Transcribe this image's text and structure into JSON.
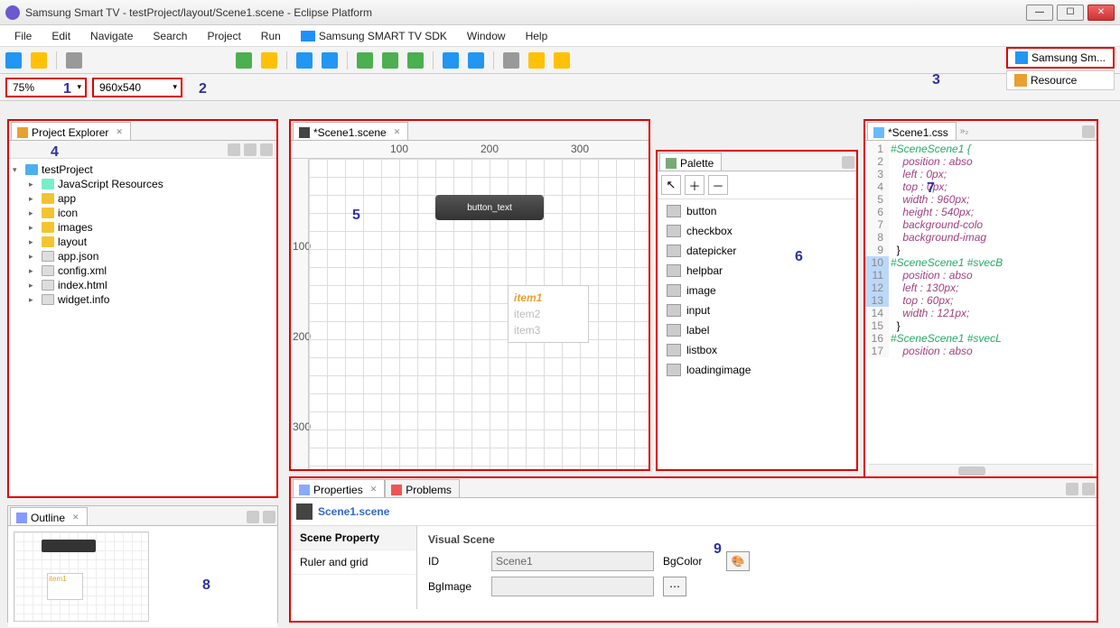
{
  "window": {
    "title": "Samsung Smart TV - testProject/layout/Scene1.scene - Eclipse Platform"
  },
  "menu": {
    "items": [
      "File",
      "Edit",
      "Navigate",
      "Search",
      "Project",
      "Run",
      "Samsung SMART TV SDK",
      "Window",
      "Help"
    ]
  },
  "toolbar": {
    "zoom": "75%",
    "resolution": "960x540"
  },
  "perspective": {
    "samsung": "Samsung Sm...",
    "resource": "Resource"
  },
  "annotations": {
    "a1": "1",
    "a2": "2",
    "a3": "3",
    "a4": "4",
    "a5": "5",
    "a6": "6",
    "a7": "7",
    "a8": "8",
    "a9": "9"
  },
  "projectExplorer": {
    "title": "Project Explorer",
    "root": "testProject",
    "children": [
      {
        "label": "JavaScript Resources",
        "type": "lib"
      },
      {
        "label": "app",
        "type": "folder"
      },
      {
        "label": "icon",
        "type": "folder"
      },
      {
        "label": "images",
        "type": "folder"
      },
      {
        "label": "layout",
        "type": "folder"
      },
      {
        "label": "app.json",
        "type": "file"
      },
      {
        "label": "config.xml",
        "type": "file"
      },
      {
        "label": "index.html",
        "type": "file"
      },
      {
        "label": "widget.info",
        "type": "file"
      }
    ]
  },
  "sceneEditor": {
    "tab": "*Scene1.scene",
    "ruler_ticks_h": [
      "100",
      "200",
      "300"
    ],
    "ruler_ticks_v": [
      "100",
      "200",
      "300"
    ],
    "button_label": "button_text",
    "list_items": [
      "item1",
      "item2",
      "item3"
    ]
  },
  "palette": {
    "title": "Palette",
    "items": [
      "button",
      "checkbox",
      "datepicker",
      "helpbar",
      "image",
      "input",
      "label",
      "listbox",
      "loadingimage"
    ]
  },
  "cssEditor": {
    "tab": "*Scene1.css",
    "lines": [
      {
        "n": 1,
        "t": "#SceneScene1 {",
        "cls": "sel"
      },
      {
        "n": 2,
        "t": "    position : abso",
        "cls": "prop"
      },
      {
        "n": 3,
        "t": "    left : 0px;",
        "cls": "prop"
      },
      {
        "n": 4,
        "t": "    top : 0px;",
        "cls": "prop"
      },
      {
        "n": 5,
        "t": "    width : 960px;",
        "cls": "prop"
      },
      {
        "n": 6,
        "t": "    height : 540px;",
        "cls": "prop"
      },
      {
        "n": 7,
        "t": "    background-colo",
        "cls": "prop"
      },
      {
        "n": 8,
        "t": "    background-imag",
        "cls": "prop"
      },
      {
        "n": 9,
        "t": "  }",
        "cls": ""
      },
      {
        "n": 10,
        "t": "#SceneScene1 #svecB",
        "cls": "sel",
        "hl": true
      },
      {
        "n": 11,
        "t": "    position : abso",
        "cls": "prop",
        "hl": true
      },
      {
        "n": 12,
        "t": "    left : 130px;",
        "cls": "prop",
        "hl": true
      },
      {
        "n": 13,
        "t": "    top : 60px;",
        "cls": "prop",
        "hl": true
      },
      {
        "n": 14,
        "t": "    width : 121px;",
        "cls": "prop"
      },
      {
        "n": 15,
        "t": "  }",
        "cls": ""
      },
      {
        "n": 16,
        "t": "#SceneScene1 #svecL",
        "cls": "sel"
      },
      {
        "n": 17,
        "t": "    position : abso",
        "cls": "prop"
      }
    ]
  },
  "outline": {
    "title": "Outline"
  },
  "properties": {
    "tab": "Properties",
    "problems_tab": "Problems",
    "scene_name": "Scene1.scene",
    "side": {
      "head": "Scene Property",
      "item": "Ruler and grid"
    },
    "form": {
      "section": "Visual Scene",
      "id_label": "ID",
      "id_value": "Scene1",
      "bgcolor_label": "BgColor",
      "bgimage_label": "BgImage"
    }
  }
}
